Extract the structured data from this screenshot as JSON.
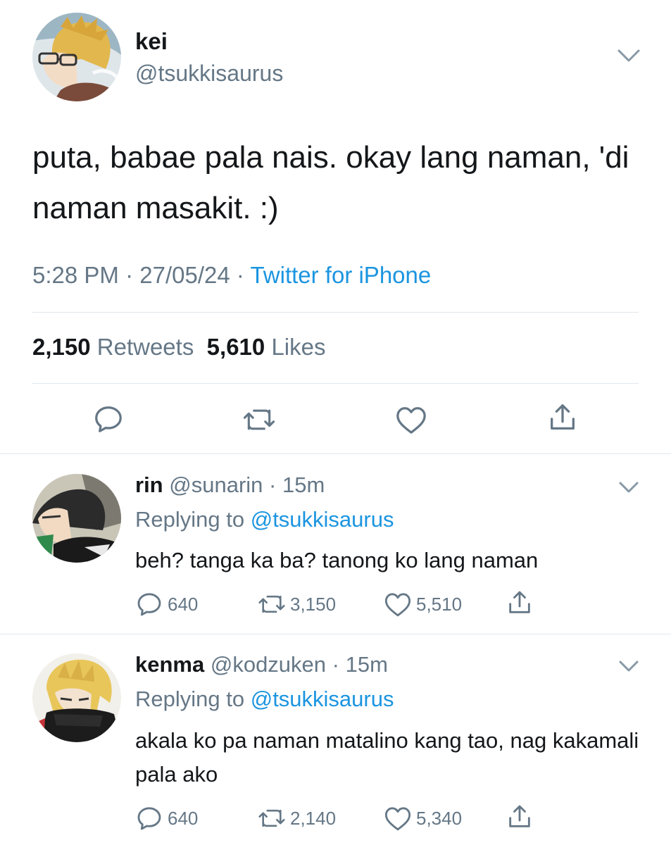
{
  "main_tweet": {
    "display_name": "kei",
    "handle": "@tsukkisaurus",
    "text": "puta, babae pala nais. okay lang naman, 'di naman masakit. :)",
    "time": "5:28 PM",
    "date": "27/05/24",
    "source": "Twitter for iPhone",
    "retweets_count": "2,150",
    "retweets_label": "Retweets",
    "likes_count": "5,610",
    "likes_label": "Likes"
  },
  "replies": [
    {
      "display_name": "rin",
      "handle": "@sunarin",
      "time": "15m",
      "replying_label": "Replying to",
      "replying_to": "@tsukkisaurus",
      "text": "beh? tanga ka ba? tanong ko lang naman",
      "reply_count": "640",
      "retweet_count": "3,150",
      "like_count": "5,510"
    },
    {
      "display_name": "kenma",
      "handle": "@kodzuken",
      "time": "15m",
      "replying_label": "Replying to",
      "replying_to": "@tsukkisaurus",
      "text": "akala ko pa naman matalino kang tao, nag kakamali pala ako",
      "reply_count": "640",
      "retweet_count": "2,140",
      "like_count": "5,340"
    }
  ],
  "icons": {
    "reply": "reply-icon",
    "retweet": "retweet-icon",
    "like": "heart-icon",
    "share": "share-icon",
    "more": "chevron-down-icon"
  },
  "colors": {
    "text": "#14171a",
    "secondary": "#657786",
    "link": "#1b95e0",
    "divider": "#e1e8ed",
    "icon": "#657786"
  }
}
